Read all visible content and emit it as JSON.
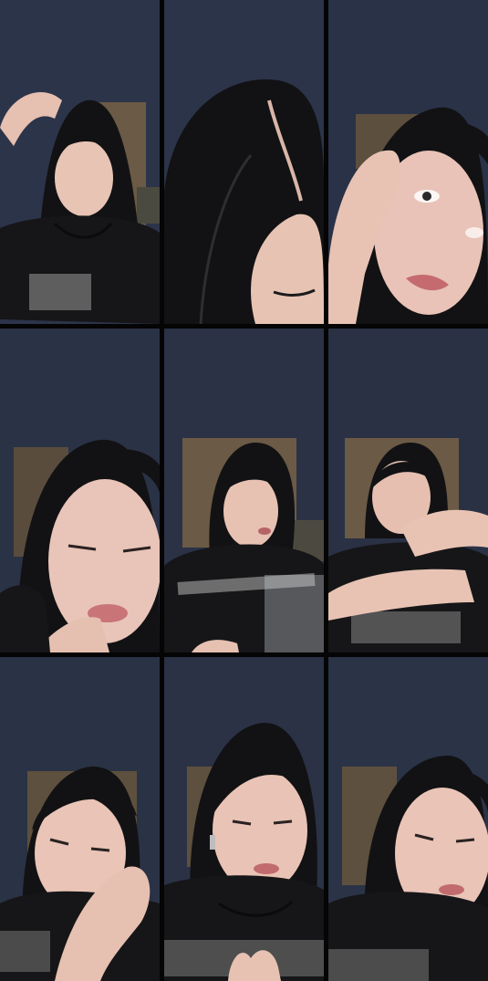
{
  "grid": {
    "rows": 3,
    "cols": 3,
    "tiles": [
      {
        "pose": "hand-on-head",
        "bg": "#2b3449"
      },
      {
        "pose": "head-top-closeup",
        "bg": "#2c3449"
      },
      {
        "pose": "hand-on-cheek-closeup",
        "bg": "#2a3247"
      },
      {
        "pose": "finger-on-lip",
        "bg": "#2a3246"
      },
      {
        "pose": "front-with-plastic",
        "bg": "#2b3246"
      },
      {
        "pose": "arms-raised",
        "bg": "#2a3145"
      },
      {
        "pose": "tilted-with-hand",
        "bg": "#2a3245"
      },
      {
        "pose": "front-talking",
        "bg": "#2b3246"
      },
      {
        "pose": "leaning-closeup",
        "bg": "#2b3347"
      }
    ]
  },
  "colors": {
    "wall": "#2b3349",
    "hair": "#121214",
    "skin": "#e9c4b6",
    "shirt": "#161618",
    "furniture": "#6b5a45"
  }
}
